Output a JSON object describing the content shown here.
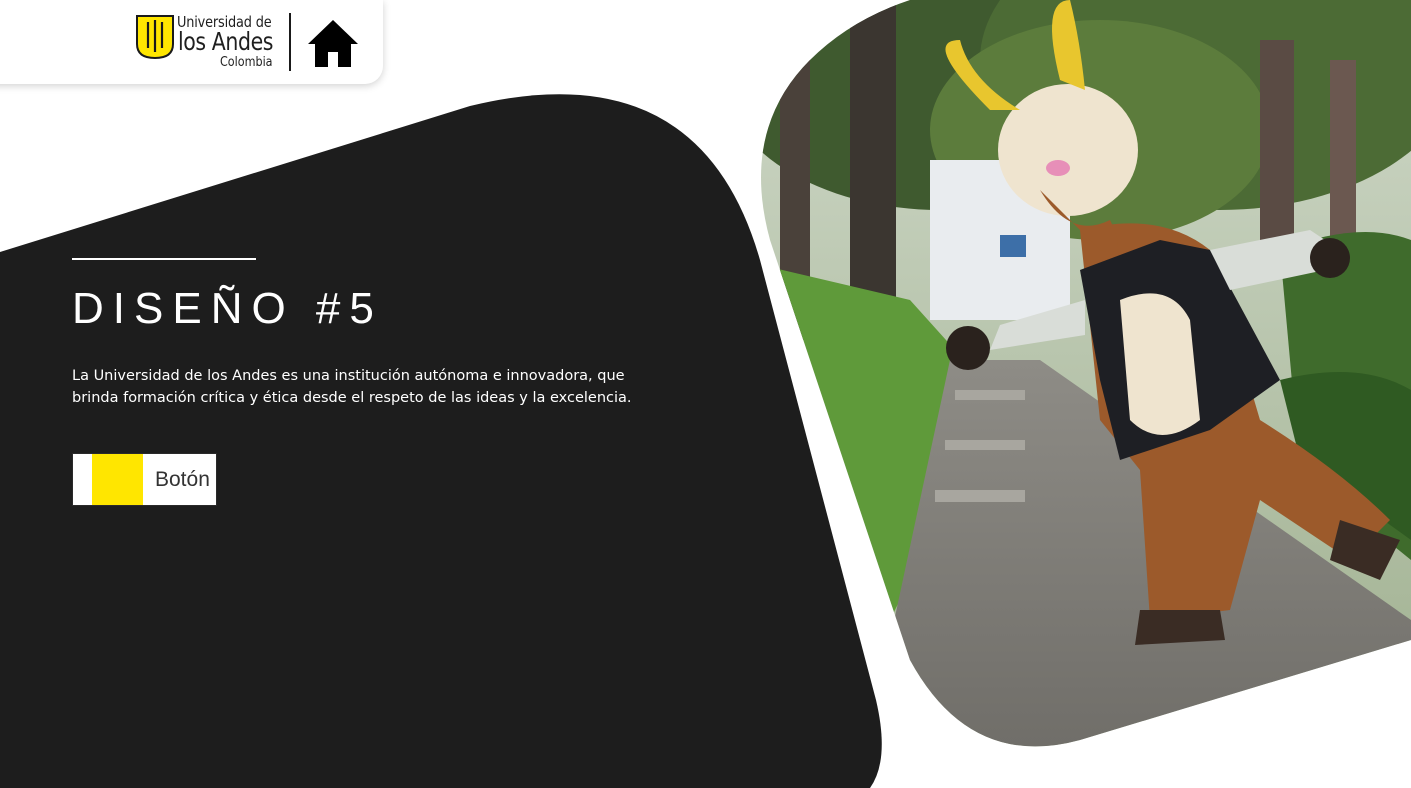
{
  "brand": {
    "logo_line1": "Universidad de",
    "logo_line2": "los Andes",
    "logo_line3": "Colombia",
    "primary_yellow": "#FFE600",
    "dark_panel_color": "#1D1D1D"
  },
  "header": {
    "home_icon": "home-icon"
  },
  "hero": {
    "title": "DISEÑO #5",
    "description": "La Universidad de los Andes es una institución autónoma e innovadora, que brinda formación crítica y ética desde el respeto de las ideas y la excelencia.",
    "button_label": "Botón"
  },
  "photo": {
    "subject": "goat-mascot-photo"
  }
}
